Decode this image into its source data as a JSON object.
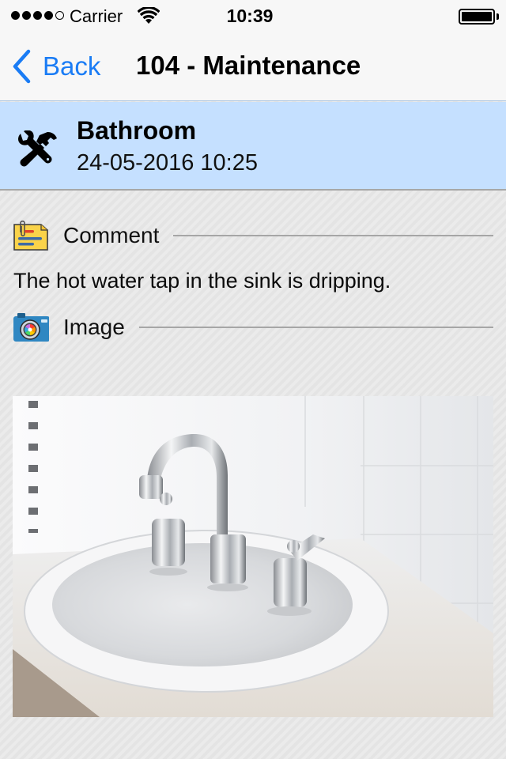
{
  "status_bar": {
    "signal_bars_filled": 4,
    "signal_bars_total": 5,
    "carrier": "Carrier",
    "time": "10:39",
    "battery_level": 1.0,
    "icons": [
      "signal-dots-icon",
      "wifi-icon",
      "battery-icon"
    ]
  },
  "nav": {
    "back_label": "Back",
    "title": "104 - Maintenance",
    "accent_color": "#1a7cf5"
  },
  "header": {
    "icon": "tools-icon",
    "category": "Bathroom",
    "timestamp": "24-05-2016 10:25",
    "background_color": "#c5e0ff"
  },
  "sections": {
    "comment": {
      "icon": "note-icon",
      "label": "Comment",
      "text": "The hot water tap in the sink is dripping."
    },
    "image": {
      "icon": "camera-icon",
      "label": "Image",
      "photo_description": "White bathroom sink with chrome faucet and handles"
    }
  }
}
